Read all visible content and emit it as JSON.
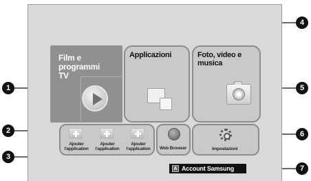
{
  "tiles": {
    "film": {
      "title": "Film e\nprogrammi\nTV"
    },
    "apps": {
      "title": "Applicazioni"
    },
    "media": {
      "title": "Foto, video e\nmusica"
    }
  },
  "add_apps": [
    {
      "label": "Ajouter\nl'application"
    },
    {
      "label": "Ajouter\nl'application"
    },
    {
      "label": "Ajouter\nl'application"
    }
  ],
  "web_browser": {
    "label": "Web Browser"
  },
  "settings": {
    "label": "Impostazioni"
  },
  "account": {
    "key": "A",
    "label": "Account Samsung"
  },
  "callouts": [
    "1",
    "2",
    "3",
    "4",
    "5",
    "6",
    "7"
  ],
  "icons": {
    "play": "play-icon",
    "apps": "apps-icon",
    "camera": "camera-icon",
    "add": "plus-icon",
    "globe": "globe-icon",
    "gear": "gear-icon"
  },
  "colors": {
    "screen_bg": "#d9d9d9",
    "tile_bg": "#c9c9c9",
    "film_bg": "#909090",
    "callout_bg": "#111111"
  }
}
